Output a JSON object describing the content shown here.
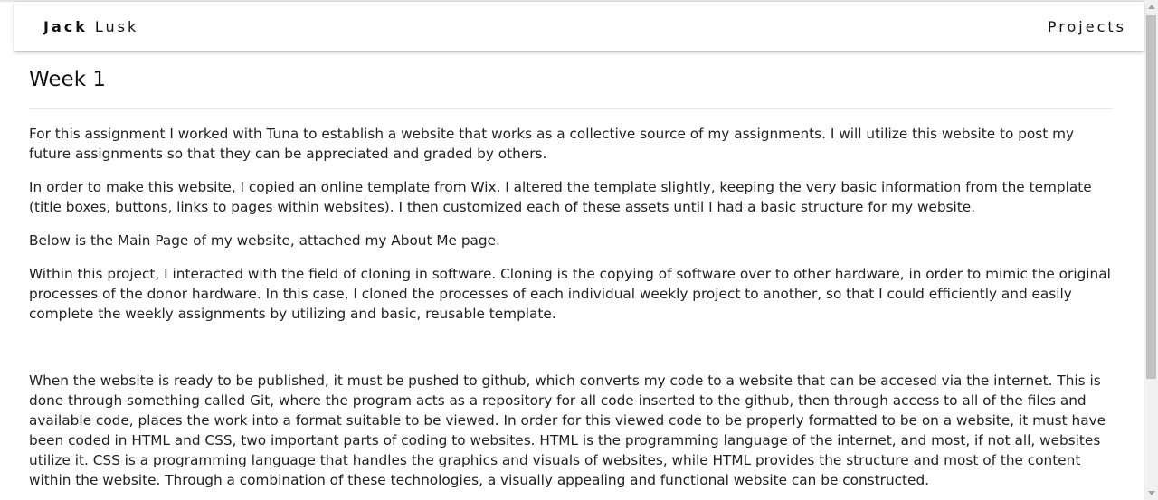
{
  "nav": {
    "brand_first": "Jack",
    "brand_last": "Lusk",
    "projects_label": "Projects"
  },
  "page": {
    "title": "Week 1",
    "paragraphs": [
      "For this assignment I worked with Tuna to establish a website that works as a collective source of my assignments. I will utilize this website to post my future assignments so that they can be appreciated and graded by others.",
      "In order to make this website, I copied an online template from Wix. I altered the template slightly, keeping the very basic information from the template (title boxes, buttons, links to pages within websites). I then customized each of these assets until I had a basic structure for my website.",
      "Below is the Main Page of my website, attached my About Me page.",
      "Within this project, I interacted with the field of cloning in software. Cloning is the copying of software over to other hardware, in order to mimic the original processes of the donor hardware. In this case, I cloned the processes of each individual weekly project to another, so that I could efficiently and easily complete the weekly assignments by utilizing and basic, reusable template.",
      "When the website is ready to be published, it must be pushed to github, which converts my code to a website that can be accesed via the internet. This is done through something called Git, where the program acts as a repository for all code inserted to the github, then through access to all of the files and available code, places the work into a format suitable to be viewed. In order for this viewed code to be properly formatted to be on a website, it must have been coded in HTML and CSS, two important parts of coding to websites. HTML is the programming language of the internet, and most, if not all, websites utilize it. CSS is a programming language that handles the graphics and visuals of websites, while HTML provides the structure and most of the content within the website. Through a combination of these technologies, a visually appealing and functional website can be constructed."
    ]
  },
  "colors": {
    "background": "#ffffff",
    "text": "#222222",
    "divider": "#e8e8e8"
  }
}
